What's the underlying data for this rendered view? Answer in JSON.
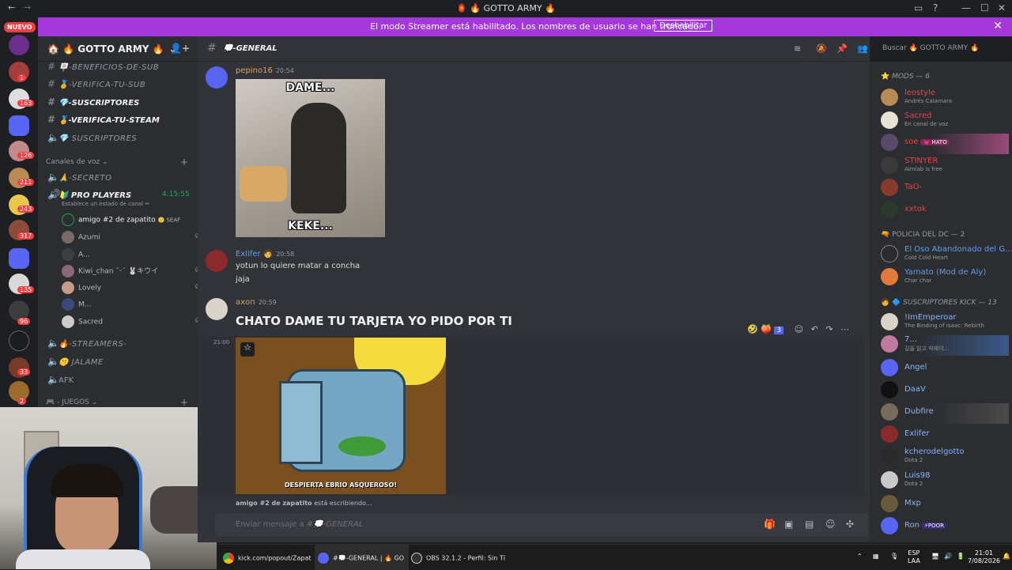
{
  "window": {
    "title": "🏮 🔥 GOTTO ARMY 🔥"
  },
  "banner": {
    "text": "El modo Streamer está habilitado. Los nombres de usuario se han truncado.",
    "button": "Deshabilitar"
  },
  "guilds": {
    "new_badge": "NUEVO",
    "badges": [
      "1",
      "163",
      "126",
      "211",
      "243",
      "317",
      "135",
      "96",
      "33",
      "2"
    ]
  },
  "server": {
    "name": "🔥 GOTTO ARMY 🔥"
  },
  "channels": {
    "text": [
      {
        "name": "🪧-BENEFICIOS-DE-SUB"
      },
      {
        "name": "🏅-VERIFICA-TU-SUB"
      },
      {
        "name": "💎-SUSCRIPTORES"
      },
      {
        "name": "🏅-VERIFICA-TU-STEAM"
      },
      {
        "name": "💎 SUSCRIPTORES"
      }
    ],
    "voice_category": "Canales de voz",
    "voice": [
      {
        "name": "🙏-SECRETO"
      },
      {
        "name": "🔰 PRO PLAYERS",
        "timer": "4:15:55",
        "status": "Establece un estado de canal ✏"
      }
    ],
    "voice_users": [
      {
        "name": "amigo #2 de zapatito",
        "badge": "🙁 SEAF"
      },
      {
        "name": "Azumi"
      },
      {
        "name": "A..."
      },
      {
        "name": "Kiwi_chan ˘ᵕ˘ 🐰キウイ"
      },
      {
        "name": "Lovely"
      },
      {
        "name": "M..."
      },
      {
        "name": "Sacred"
      }
    ],
    "more": [
      {
        "name": "🔥-STREAMERS-"
      },
      {
        "name": "🤫 JALAME"
      },
      {
        "name": "AFK"
      }
    ],
    "juegos_category": "🎮 - JUEGOS"
  },
  "channel_header": {
    "name": "💭-GENERAL"
  },
  "search": {
    "placeholder": "Buscar 🔥 GOTTO ARMY 🔥"
  },
  "messages": [
    {
      "author": "pepino16",
      "time": "20:54",
      "gif_top": "DAME...",
      "gif_bottom": "KEKE..."
    },
    {
      "author": "Exlifer",
      "time": "20:58",
      "lines": [
        "yotun lo quiere matar a concha",
        "jaja"
      ]
    },
    {
      "author": "ахоп",
      "time": "20:59",
      "big": "CHATO DAME TU TARJETA YO PIDO POR TI"
    },
    {
      "time": "21:00",
      "gif_caption": "DESPIERTA EBRIO ASQUEROSO!"
    }
  ],
  "reactions": {
    "count": "3"
  },
  "typing": {
    "name": "amigo #2 de zapatito",
    "suffix": "está escribiendo..."
  },
  "composer": {
    "placeholder_prefix": "Enviar mensaje a #",
    "placeholder_channel": "💭-GENERAL"
  },
  "members": {
    "mods_label": "MODS — 6",
    "mods": [
      {
        "name": "leostyle",
        "sub": "Andrés Calamaro",
        "color": "#f23f43"
      },
      {
        "name": "Sacred",
        "sub": "En canal de voz",
        "color": "#f23f43"
      },
      {
        "name": "soe",
        "tag": "💗 HATO",
        "color": "#f23f43"
      },
      {
        "name": "STINYER",
        "sub": "Aimlab is free",
        "color": "#f23f43"
      },
      {
        "name": "TaO-",
        "color": "#f23f43"
      },
      {
        "name": "xxtok",
        "color": "#f23f43"
      }
    ],
    "policia_label": "POLICIA DEL DC — 2",
    "policia": [
      {
        "name": "El Oso Abandonado del G...",
        "sub": "Cold Cold Heart",
        "color": "#5f9ff0"
      },
      {
        "name": "Yamato (Mod de Aly)",
        "sub": "Char char",
        "color": "#5f9ff0"
      }
    ],
    "subs_label": "SUSCRIPTORES KICK — 13",
    "subs": [
      {
        "name": "!ImEmperoar",
        "sub": "The Binding of Isaac: Rebirth",
        "color": "#89b4fa"
      },
      {
        "name": "7...",
        "sub": "길을 잃고 마에이...",
        "color": "#89b4fa"
      },
      {
        "name": "Angel",
        "color": "#89b4fa"
      },
      {
        "name": "DaaV",
        "color": "#89b4fa"
      },
      {
        "name": "Dubfire",
        "color": "#89b4fa"
      },
      {
        "name": "Exlifer",
        "color": "#89b4fa"
      },
      {
        "name": "kcherodelgotto",
        "sub": "Dota 2",
        "color": "#89b4fa"
      },
      {
        "name": "Luis98",
        "sub": "Dota 2",
        "color": "#89b4fa"
      },
      {
        "name": "Mxp",
        "color": "#89b4fa"
      },
      {
        "name": "Ron",
        "tag": "⚡POOR",
        "color": "#89b4fa"
      }
    ]
  },
  "taskbar": {
    "items": [
      "kick.com/popout/Zapat",
      "#💭-GENERAL | 🔥 GO",
      "OBS 32.1.2 - Perfil: Sin Tí"
    ],
    "lang": "ESP",
    "lang2": "LAA",
    "time": "21:01",
    "date": "7/08/2026"
  }
}
